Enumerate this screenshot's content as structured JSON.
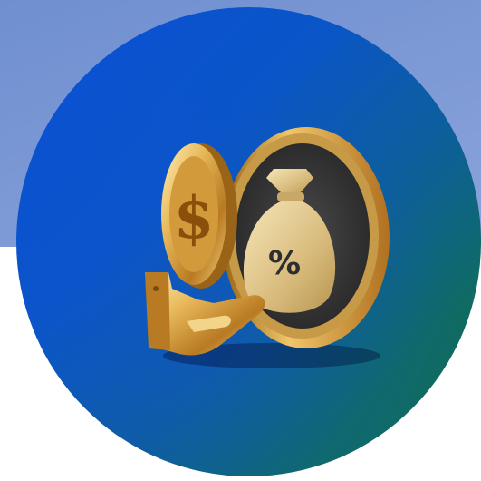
{
  "scene": {
    "background_band_color": "#7e9ad6",
    "circle_gradient": [
      "#0b4fd6",
      "#0f6d55"
    ],
    "gold_color": "#d9a441",
    "dark_coin_color": "#3a3a3a",
    "coin_symbol": "$",
    "bag_symbol": "%",
    "icons": [
      "hand-icon",
      "dollar-coin-icon",
      "money-bag-coin-icon"
    ]
  }
}
